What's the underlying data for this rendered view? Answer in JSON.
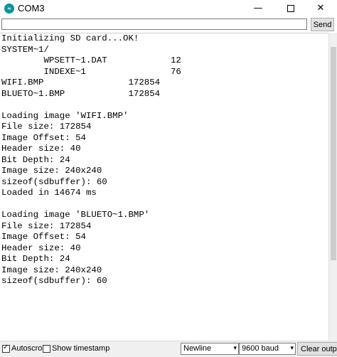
{
  "window": {
    "title": "COM3",
    "icon": "arduino-icon",
    "minimize_glyph": "—",
    "close_glyph": "✕"
  },
  "send": {
    "input_value": "",
    "button_label": "Send"
  },
  "output": {
    "lines": [
      "Initializing SD card...OK!",
      "SYSTEM~1/",
      "        WPSETT~1.DAT            12",
      "        INDEXE~1                76",
      "WIFI.BMP                172854",
      "BLUETO~1.BMP            172854",
      "",
      "Loading image 'WIFI.BMP'",
      "File size: 172854",
      "Image Offset: 54",
      "Header size: 40",
      "Bit Depth: 24",
      "Image size: 240x240",
      "sizeof(sdbuffer): 60",
      "Loaded in 14674 ms",
      "",
      "Loading image 'BLUETO~1.BMP'",
      "File size: 172854",
      "Image Offset: 54",
      "Header size: 40",
      "Bit Depth: 24",
      "Image size: 240x240",
      "sizeof(sdbuffer): 60"
    ]
  },
  "footer": {
    "autoscroll_label": "Autoscroll",
    "autoscroll_checked": true,
    "timestamp_label": "Show timestamp",
    "timestamp_checked": false,
    "line_ending": "Newline",
    "baud_rate": "9600 baud",
    "clear_label": "Clear output"
  }
}
